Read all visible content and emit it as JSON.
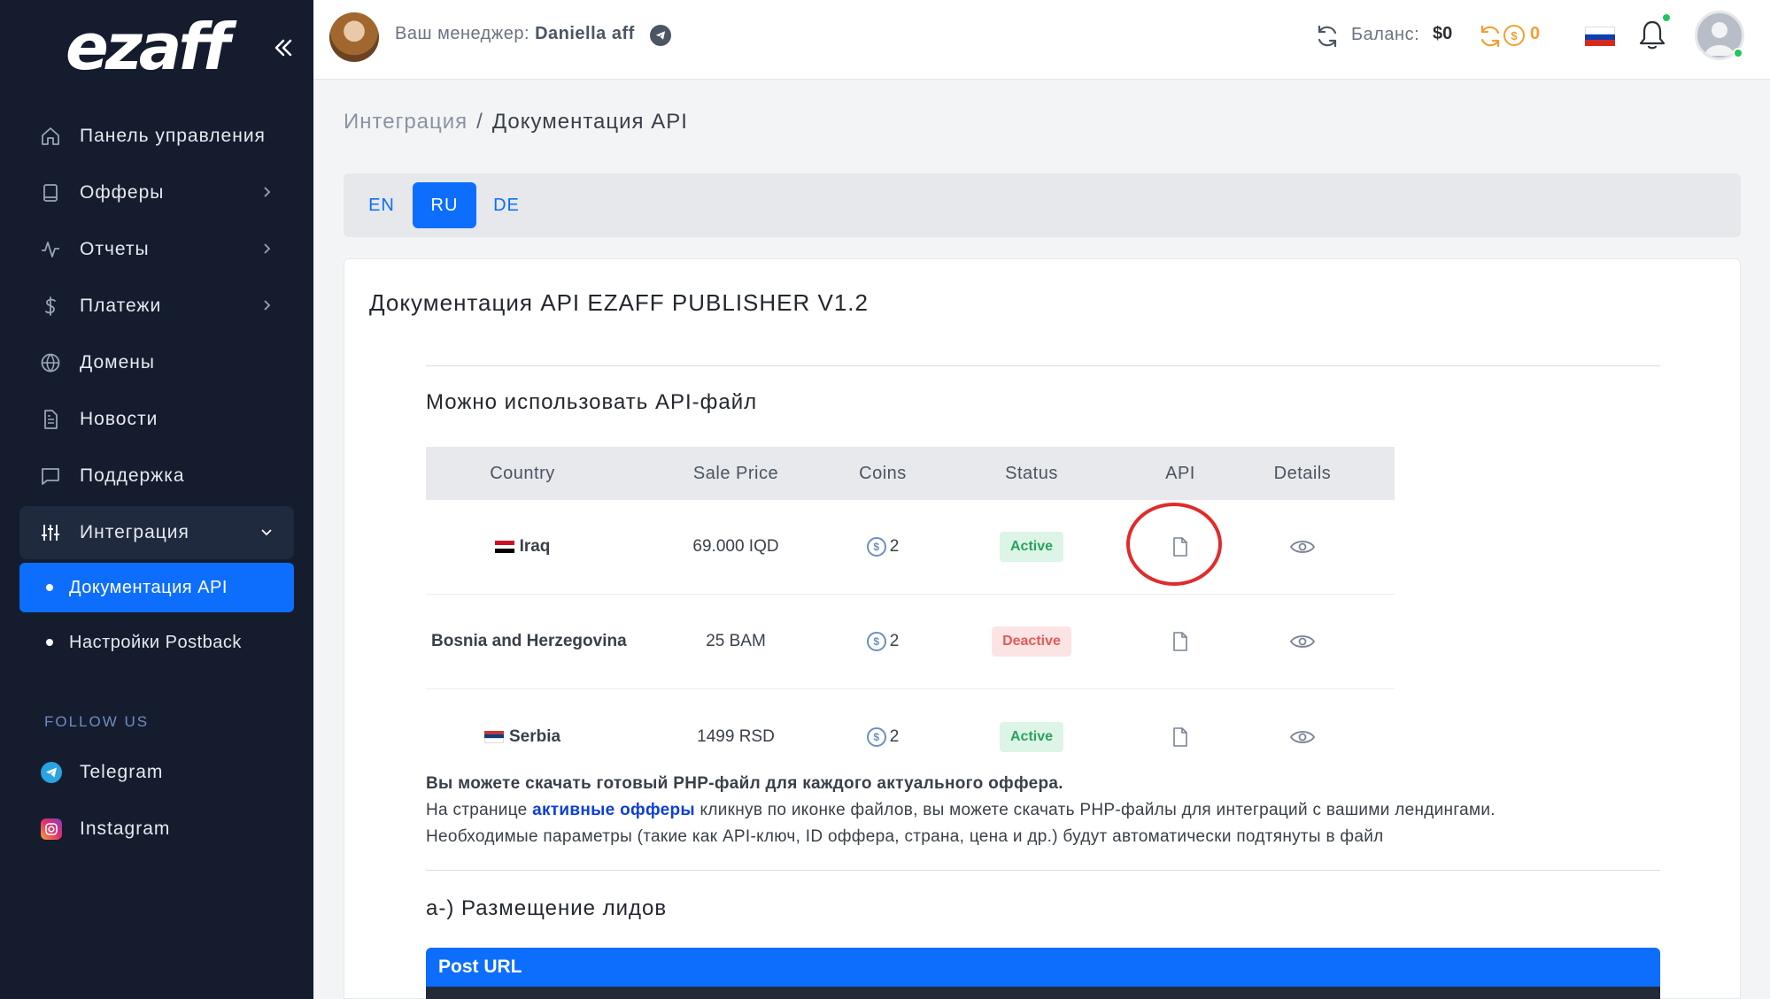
{
  "logo": {
    "text": "ezaff"
  },
  "sidebar": {
    "items": [
      {
        "label": "Панель управления"
      },
      {
        "label": "Офферы"
      },
      {
        "label": "Отчеты"
      },
      {
        "label": "Платежи"
      },
      {
        "label": "Домены"
      },
      {
        "label": "Новости"
      },
      {
        "label": "Поддержка"
      },
      {
        "label": "Интеграция"
      }
    ],
    "sub_items": [
      {
        "label": "Документация API"
      },
      {
        "label": "Настройки Postback"
      }
    ],
    "follow_label": "FOLLOW US",
    "social": [
      {
        "label": "Telegram"
      },
      {
        "label": "Instagram"
      }
    ]
  },
  "header": {
    "manager_label": "Ваш менеджер:",
    "manager_name": "Daniella aff",
    "balance_label": "Баланс:",
    "balance_value": "$0",
    "coins_value": "0"
  },
  "breadcrumb": {
    "parent": "Интеграция",
    "separator": "/",
    "current": "Документация API"
  },
  "lang_tabs": [
    "EN",
    "RU",
    "DE"
  ],
  "card": {
    "title": "Документация API EZAFF PUBLISHER V1.2",
    "section1": "Можно использовать API-файл",
    "table": {
      "headers": [
        "Country",
        "Sale Price",
        "Coins",
        "Status",
        "API",
        "Details"
      ],
      "rows": [
        {
          "country": "Iraq",
          "price": "69.000 IQD",
          "coins": "2",
          "status": "Active"
        },
        {
          "country": "Bosnia and Herzegovina",
          "price": "25 BAM",
          "coins": "2",
          "status": "Deactive"
        },
        {
          "country": "Serbia",
          "price": "1499 RSD",
          "coins": "2",
          "status": "Active"
        }
      ]
    },
    "info": {
      "line1": "Вы можете скачать готовый PHP-файл для каждого актуального оффера.",
      "line2_pre": "На странице ",
      "line2_link": "активные офферы",
      "line2_post": " кликнув по иконке файлов, вы можете скачать PHP-файлы для интеграций с вашими лендингами.",
      "line3": "Необходимые параметры (такие как API-ключ, ID оффера, страна, цена и др.) будут автоматически подтянуты в файл"
    },
    "section2": "a-) Размещение лидов",
    "post_url_label": "Post URL"
  },
  "colors": {
    "sidebar_bg": "#141c2e",
    "accent": "#0d6efd",
    "active_badge": "#2aa15e",
    "deactive_badge": "#e15a5a",
    "coin": "#f0a030"
  }
}
